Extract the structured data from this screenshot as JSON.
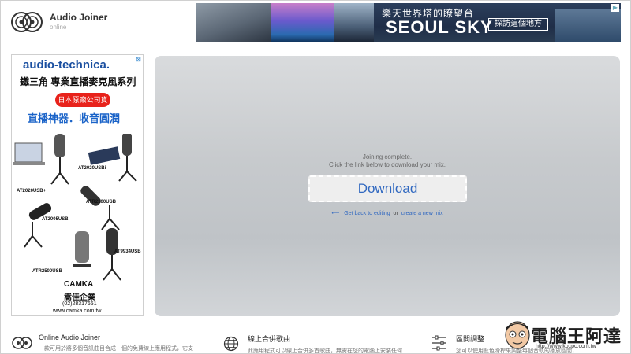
{
  "app": {
    "name": "Audio Joiner",
    "subtitle": "online"
  },
  "top_ad": {
    "headline_cn": "樂天世界塔的瞭望台",
    "headline_en": "SEOUL SKY",
    "button_label": "探訪這個地方",
    "close_glyph": "▶"
  },
  "side_ad": {
    "brand": "audio-technica.",
    "close_glyph": "⊠",
    "title": "鐵三角 專業直播麥克風系列",
    "pill": "日本原廠公司貨",
    "slogan": "直播神器．收音圓潤",
    "models": [
      "AT2020USBi",
      "AT2020USB+",
      "ATR2100USB",
      "AT2005USB",
      "AT9934USB",
      "ATR2500USB"
    ],
    "distributor_logo": "CAMKA",
    "distributor_cn": "嵩佳企業",
    "phone": "(02)28317651",
    "url": "www.camka.com.tw"
  },
  "result": {
    "line1": "Joining complete.",
    "line2": "Click the link below to download your mix.",
    "download_label": "Download",
    "back_arrow": "⟵",
    "back_label": "Get back to editing",
    "or_label": "or",
    "new_label": "create a new mix"
  },
  "features": [
    {
      "title": "Online Audio Joiner",
      "desc": "一款可用於將多個音訊曲目合成一個的免費線上應用程式，它支",
      "icon": "vinyl-icon"
    },
    {
      "title": "線上合併歌曲",
      "desc": "此應用程式可以線上合併多首歌曲，無需在您的電腦上安裝任何",
      "icon": "globe-icon"
    },
    {
      "title": "區間調整",
      "desc": "您可以使用藍色滑桿來調整每個音軌的播放區間，",
      "icon": "sliders-icon"
    }
  ],
  "watermark": {
    "title": "電腦王阿達",
    "url": "http://www.kocpc.com.tw"
  },
  "colors": {
    "link": "#3068c0",
    "panel": "#c7cacd",
    "brand_blue": "#1a4fa0",
    "ad_red": "#e8221b"
  }
}
